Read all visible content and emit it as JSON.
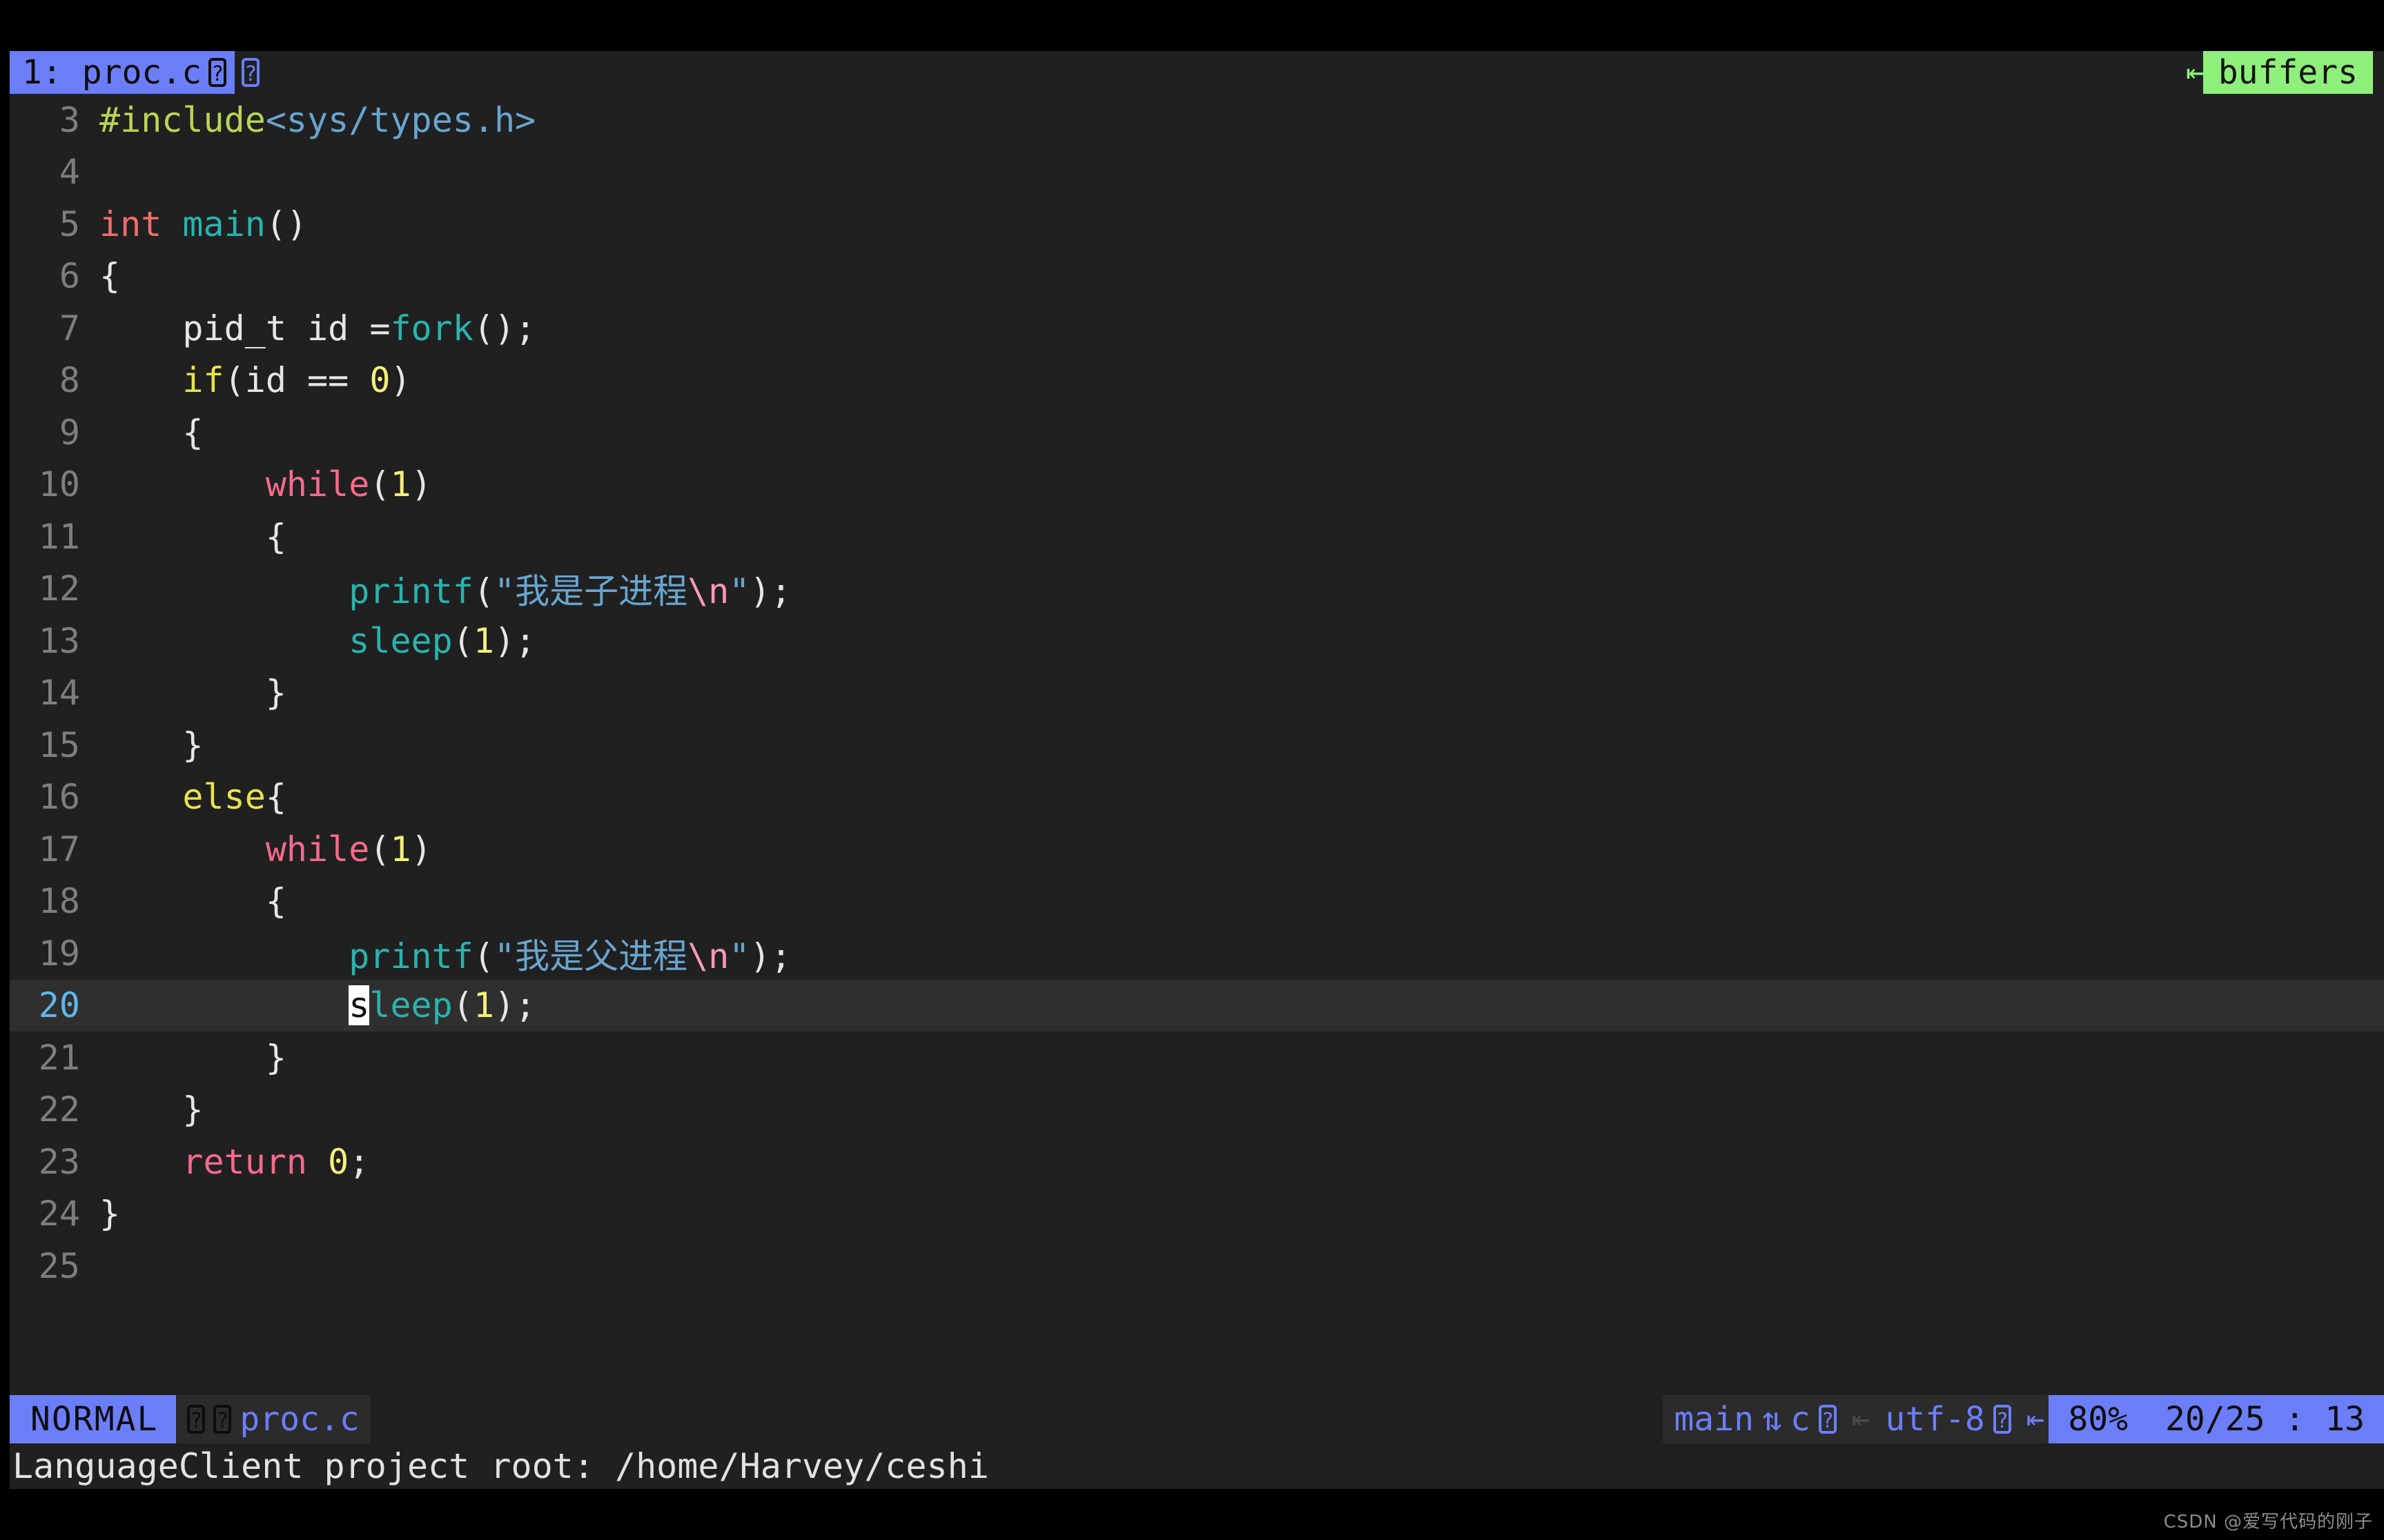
{
  "colors": {
    "terminal_background": "#000000",
    "editor_background": "#202020",
    "cursor_line_background": "#2f2f2f",
    "accent_blue": "#6c7ef7",
    "accent_green": "#8ef07a",
    "line_number": "#7e7e7e",
    "current_line_number": "#61b6e8",
    "cursor": "#ffffff"
  },
  "tabline": {
    "tab_label": "1: proc.c",
    "tab_icon_1": "unknown-glyph-icon",
    "tab_icon_1_text": "?",
    "tab_icon_2": "unknown-glyph-icon",
    "tab_icon_2_text": "?",
    "separator_icon": "left-arrow-separator-icon",
    "separator_glyph": "⇤",
    "buffers_label": "buffers"
  },
  "editor": {
    "first_visible_line": 3,
    "last_visible_line": 25,
    "current_line": 20,
    "lines": [
      {
        "num": "3",
        "current": false,
        "tokens": [
          {
            "t": "#include",
            "c": "c-pre"
          },
          {
            "t": "<sys/types.h>",
            "c": "c-inc"
          }
        ]
      },
      {
        "num": "4",
        "current": false,
        "tokens": []
      },
      {
        "num": "5",
        "current": false,
        "tokens": [
          {
            "t": "int ",
            "c": "c-type"
          },
          {
            "t": "main",
            "c": "c-func"
          },
          {
            "t": "()",
            "c": "c-plain"
          }
        ]
      },
      {
        "num": "6",
        "current": false,
        "tokens": [
          {
            "t": "{",
            "c": "c-plain"
          }
        ]
      },
      {
        "num": "7",
        "current": false,
        "tokens": [
          {
            "t": "    pid_t id =",
            "c": "c-plain"
          },
          {
            "t": "fork",
            "c": "c-func"
          },
          {
            "t": "();",
            "c": "c-plain"
          }
        ]
      },
      {
        "num": "8",
        "current": false,
        "tokens": [
          {
            "t": "    ",
            "c": "c-plain"
          },
          {
            "t": "if",
            "c": "c-kw"
          },
          {
            "t": "(id == ",
            "c": "c-plain"
          },
          {
            "t": "0",
            "c": "c-num"
          },
          {
            "t": ")",
            "c": "c-plain"
          }
        ]
      },
      {
        "num": "9",
        "current": false,
        "tokens": [
          {
            "t": "    {",
            "c": "c-plain"
          }
        ]
      },
      {
        "num": "10",
        "current": false,
        "tokens": [
          {
            "t": "        ",
            "c": "c-plain"
          },
          {
            "t": "while",
            "c": "c-loop"
          },
          {
            "t": "(",
            "c": "c-plain"
          },
          {
            "t": "1",
            "c": "c-num"
          },
          {
            "t": ")",
            "c": "c-plain"
          }
        ]
      },
      {
        "num": "11",
        "current": false,
        "tokens": [
          {
            "t": "        {",
            "c": "c-plain"
          }
        ]
      },
      {
        "num": "12",
        "current": false,
        "tokens": [
          {
            "t": "            ",
            "c": "c-plain"
          },
          {
            "t": "printf",
            "c": "c-func"
          },
          {
            "t": "(",
            "c": "c-plain"
          },
          {
            "t": "\"我是子进程",
            "c": "c-str"
          },
          {
            "t": "\\n",
            "c": "c-esc"
          },
          {
            "t": "\"",
            "c": "c-str"
          },
          {
            "t": ");",
            "c": "c-plain"
          }
        ]
      },
      {
        "num": "13",
        "current": false,
        "tokens": [
          {
            "t": "            ",
            "c": "c-plain"
          },
          {
            "t": "sleep",
            "c": "c-func"
          },
          {
            "t": "(",
            "c": "c-plain"
          },
          {
            "t": "1",
            "c": "c-num"
          },
          {
            "t": ");",
            "c": "c-plain"
          }
        ]
      },
      {
        "num": "14",
        "current": false,
        "tokens": [
          {
            "t": "        }",
            "c": "c-plain"
          }
        ]
      },
      {
        "num": "15",
        "current": false,
        "tokens": [
          {
            "t": "    }",
            "c": "c-plain"
          }
        ]
      },
      {
        "num": "16",
        "current": false,
        "tokens": [
          {
            "t": "    ",
            "c": "c-plain"
          },
          {
            "t": "else",
            "c": "c-kw"
          },
          {
            "t": "{",
            "c": "c-plain"
          }
        ]
      },
      {
        "num": "17",
        "current": false,
        "tokens": [
          {
            "t": "        ",
            "c": "c-plain"
          },
          {
            "t": "while",
            "c": "c-loop"
          },
          {
            "t": "(",
            "c": "c-plain"
          },
          {
            "t": "1",
            "c": "c-num"
          },
          {
            "t": ")",
            "c": "c-plain"
          }
        ]
      },
      {
        "num": "18",
        "current": false,
        "tokens": [
          {
            "t": "        {",
            "c": "c-plain"
          }
        ]
      },
      {
        "num": "19",
        "current": false,
        "tokens": [
          {
            "t": "            ",
            "c": "c-plain"
          },
          {
            "t": "printf",
            "c": "c-func"
          },
          {
            "t": "(",
            "c": "c-plain"
          },
          {
            "t": "\"我是父进程",
            "c": "c-str"
          },
          {
            "t": "\\n",
            "c": "c-esc"
          },
          {
            "t": "\"",
            "c": "c-str"
          },
          {
            "t": ");",
            "c": "c-plain"
          }
        ]
      },
      {
        "num": "20",
        "current": true,
        "tokens": [
          {
            "t": "            ",
            "c": "c-plain"
          },
          {
            "t": "s",
            "c": "c-func cursor"
          },
          {
            "t": "leep",
            "c": "c-func"
          },
          {
            "t": "(",
            "c": "c-plain"
          },
          {
            "t": "1",
            "c": "c-num"
          },
          {
            "t": ");",
            "c": "c-plain"
          }
        ]
      },
      {
        "num": "21",
        "current": false,
        "tokens": [
          {
            "t": "        }",
            "c": "c-plain"
          }
        ]
      },
      {
        "num": "22",
        "current": false,
        "tokens": [
          {
            "t": "    }",
            "c": "c-plain"
          }
        ]
      },
      {
        "num": "23",
        "current": false,
        "tokens": [
          {
            "t": "    ",
            "c": "c-plain"
          },
          {
            "t": "return",
            "c": "c-ret"
          },
          {
            "t": " ",
            "c": "c-plain"
          },
          {
            "t": "0",
            "c": "c-num"
          },
          {
            "t": ";",
            "c": "c-plain"
          }
        ]
      },
      {
        "num": "24",
        "current": false,
        "tokens": [
          {
            "t": "}",
            "c": "c-plain"
          }
        ]
      },
      {
        "num": "25",
        "current": false,
        "tokens": []
      }
    ]
  },
  "statusline": {
    "mode": "NORMAL",
    "file_icon_1": "unknown-glyph-icon",
    "file_icon_1_text": "?",
    "file_icon_2": "unknown-glyph-icon",
    "file_icon_2_text": "?",
    "filename": "proc.c",
    "branch": "main",
    "git_icon": "updown-arrows-icon",
    "git_glyph": "⇅",
    "filetype": "c",
    "filetype_icon": "unknown-glyph-icon",
    "filetype_icon_text": "?",
    "separator_icon": "left-arrow-separator-icon",
    "separator_glyph": "⇤",
    "encoding": "utf-8",
    "encoding_icon": "unknown-glyph-icon",
    "encoding_icon_text": "?",
    "percent": "80%",
    "position": "20/25 : 13"
  },
  "message": {
    "text": "LanguageClient project root: /home/Harvey/ceshi"
  },
  "watermark": {
    "text": "CSDN @爱写代码的刚子"
  }
}
